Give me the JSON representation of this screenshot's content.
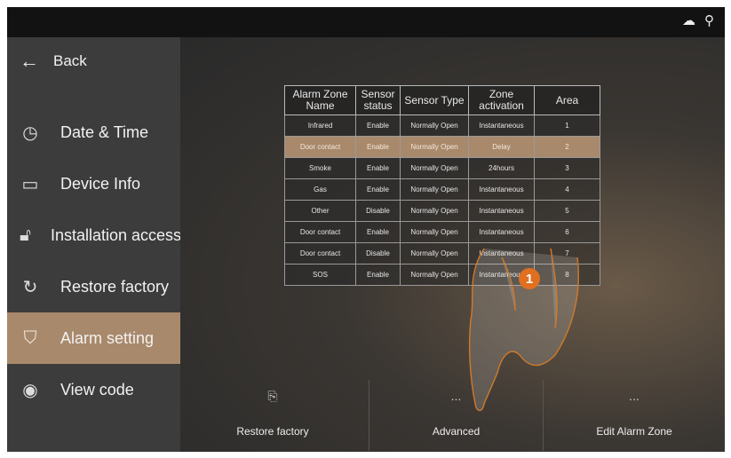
{
  "topbar": {
    "cloud_icon": "cloud-icon",
    "network_icon": "network-icon"
  },
  "sidebar": {
    "back_label": "Back",
    "items": [
      {
        "label": "Date & Time",
        "icon": "clock-icon"
      },
      {
        "label": "Device Info",
        "icon": "device-info-icon"
      },
      {
        "label": "Installation access",
        "icon": "lock-icon"
      },
      {
        "label": "Restore factory",
        "icon": "restore-icon"
      },
      {
        "label": "Alarm setting",
        "icon": "alarm-shield-icon",
        "active": true
      },
      {
        "label": "View code",
        "icon": "eye-icon"
      }
    ]
  },
  "table": {
    "headers": [
      "Alarm Zone Name",
      "Sensor status",
      "Sensor Type",
      "Zone activation",
      "Area"
    ],
    "rows": [
      [
        "Infrared",
        "Enable",
        "Normally Open",
        "Instantaneous",
        "1"
      ],
      [
        "Door contact",
        "Enable",
        "Normally Open",
        "Delay",
        "2"
      ],
      [
        "Smoke",
        "Enable",
        "Normally Open",
        "24hours",
        "3"
      ],
      [
        "Gas",
        "Enable",
        "Normally Open",
        "Instantaneous",
        "4"
      ],
      [
        "Other",
        "Disable",
        "Normally Open",
        "Instantaneous",
        "5"
      ],
      [
        "Door contact",
        "Enable",
        "Normally Open",
        "Instantaneous",
        "6"
      ],
      [
        "Door contact",
        "Disable",
        "Normally Open",
        "Instantaneous",
        "7"
      ],
      [
        "SOS",
        "Enable",
        "Normally Open",
        "Instantaneous",
        "8"
      ]
    ],
    "selected_row": 1
  },
  "bottombar": {
    "restore_label": "Restore factory",
    "advanced_label": "Advanced",
    "edit_label": "Edit Alarm Zone",
    "more_symbol": "..."
  },
  "callout": {
    "number": "1"
  },
  "colors": {
    "accent": "#a9896b",
    "callout": "#e0701f"
  }
}
